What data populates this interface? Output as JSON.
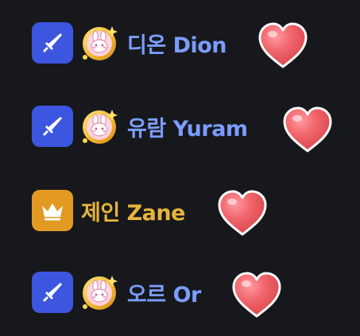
{
  "colors": {
    "background": "#17181c",
    "sword_badge": "#3d56e0",
    "crown_badge": "#e29a22",
    "member_name_blue": "#7b9dff",
    "member_name_gold": "#e6b53c",
    "heart": "#ef5b62"
  },
  "members": [
    {
      "name": "디온 Dion",
      "role_icon": "sword-icon",
      "badge_icon": "rabbit-badge-icon",
      "reaction_icon": "heart-icon"
    },
    {
      "name": "유람 Yuram",
      "role_icon": "sword-icon",
      "badge_icon": "rabbit-badge-icon",
      "reaction_icon": "heart-icon"
    },
    {
      "name": "제인 Zane",
      "role_icon": "crown-icon",
      "reaction_icon": "heart-icon"
    },
    {
      "name": "오르 Or",
      "role_icon": "sword-icon",
      "badge_icon": "rabbit-badge-icon",
      "reaction_icon": "heart-icon"
    }
  ]
}
